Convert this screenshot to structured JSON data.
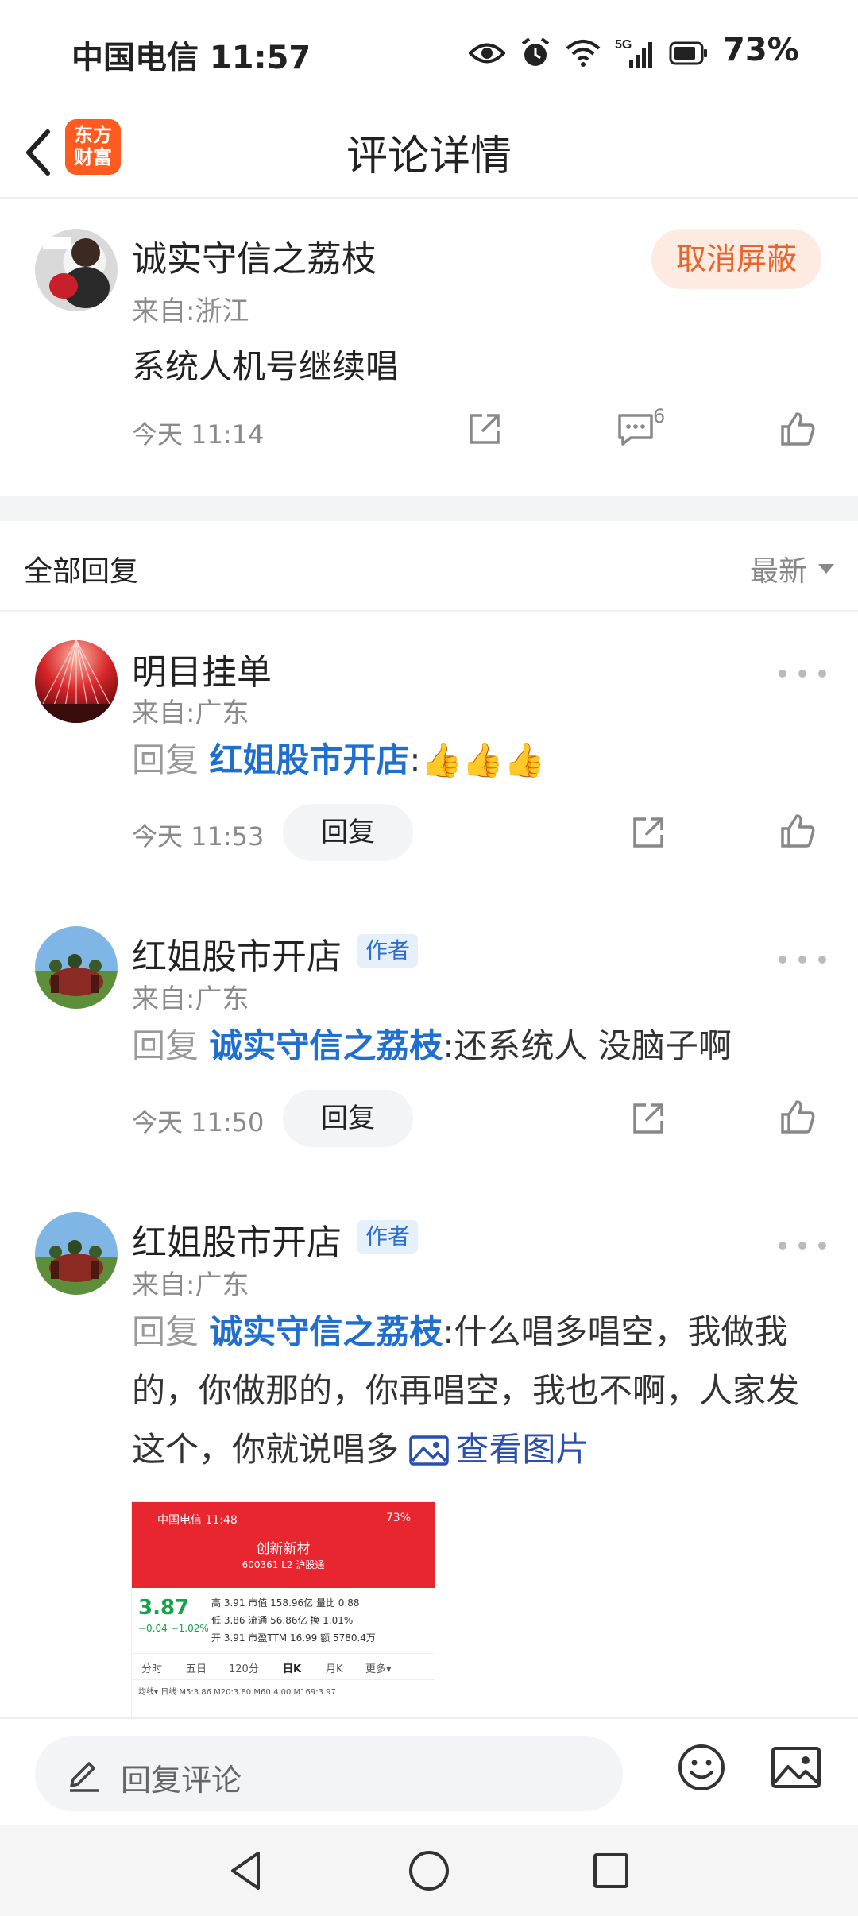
{
  "status_bar": {
    "carrier_time": "中国电信 11:57",
    "network": "5G",
    "battery": "73%",
    "icons": [
      "eye-icon",
      "alarm-icon",
      "wifi-icon",
      "signal-icon",
      "battery-icon"
    ]
  },
  "header": {
    "back_icon": "chevron-left-icon",
    "app_logo_line1": "东方",
    "app_logo_line2": "财富",
    "title": "评论详情"
  },
  "main_comment": {
    "username": "诚实守信之荔枝",
    "location": "来自:浙江",
    "text": "系统人机号继续唱",
    "time": "今天 11:14",
    "unblock_label": "取消屏蔽",
    "reply_count": "6"
  },
  "replies_section": {
    "title": "全部回复",
    "sort_label": "最新"
  },
  "replies": [
    {
      "username": "明目挂单",
      "location": "来自:广东",
      "prefix": "回复",
      "mention": "红姐股市开店",
      "separator": ":",
      "text": "👍👍👍",
      "time": "今天 11:53",
      "reply_label": "回复"
    },
    {
      "username": "红姐股市开店",
      "badge": "作者",
      "location": "来自:广东",
      "prefix": "回复",
      "mention": "诚实守信之荔枝",
      "separator": ":",
      "text": "还系统人 没脑子啊",
      "time": "今天 11:50",
      "reply_label": "回复"
    },
    {
      "username": "红姐股市开店",
      "badge": "作者",
      "location": "来自:广东",
      "prefix": "回复",
      "mention": "诚实守信之荔枝",
      "separator": ":",
      "text": "什么唱多唱空，我做我的，你做那的，你再唱空，我也不啊，人家发这个，你就说唱多",
      "view_image_label": "查看图片"
    }
  ],
  "embedded_screenshot": {
    "status_left": "中国电信 11:48",
    "status_right": "73%",
    "stock_name": "创新新材",
    "stock_code": "600361 L2 沪股通",
    "price": "3.87",
    "change": "−0.04  −1.02%",
    "row1": "高  3.91   市值 158.96亿   量比  0.88",
    "row2": "低  3.86   流通 56.86亿    换   1.01%",
    "row3": "开  3.91   市盈TTM 16.99   额 5780.4万",
    "tabs": [
      "分时",
      "五日",
      "120分",
      "日K",
      "月K",
      "更多▾"
    ],
    "ma_line": "均线▾  日线  M5:3.86  M20:3.80  M60:4.00  M169:3.97",
    "colors": {
      "header": "#e8262f",
      "down": "#15a349"
    }
  },
  "input_bar": {
    "placeholder": "回复评论",
    "icons": [
      "pencil-icon",
      "emoji-icon",
      "image-icon"
    ]
  },
  "system_nav": {
    "icons": [
      "back-triangle-icon",
      "home-circle-icon",
      "recents-square-icon"
    ]
  },
  "colors": {
    "brand_orange": "#ff5a1f",
    "mention_blue": "#1f6fd1",
    "unblock_bg": "#fdeae0",
    "unblock_text": "#e8642a"
  }
}
